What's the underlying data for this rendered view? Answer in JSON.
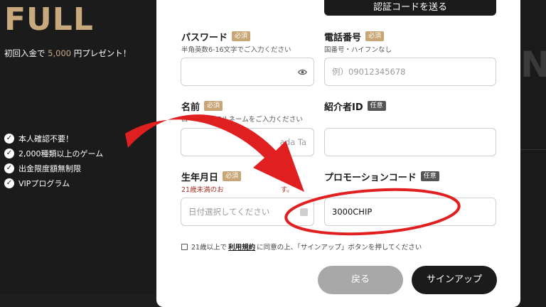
{
  "promo": {
    "title": "FULL",
    "bonus_prefix": "初回入金で",
    "bonus_amount": "5,000",
    "bonus_suffix": "円プレゼント！",
    "features": [
      "本人確認不要！",
      "2,000種類以上のゲーム",
      "出金限度額無制限",
      "VIPプログラム"
    ]
  },
  "form": {
    "auth_button": "認証コードを送る",
    "password": {
      "label": "パスワード",
      "badge": "必須",
      "hint": "半角英数6-16文字でご入力ください",
      "value": ""
    },
    "phone": {
      "label": "電話番号",
      "badge": "必須",
      "hint": "国番号・ハイフンなし",
      "placeholder": "例）09012345678"
    },
    "name": {
      "label": "名前",
      "badge": "必須",
      "hint": "ローマ字でフルネームをご入力ください",
      "placeholder": "Yamada Taro",
      "visible_placeholder": "ada Ta"
    },
    "referrer": {
      "label": "紹介者ID",
      "badge": "任意",
      "value": ""
    },
    "birthday": {
      "label": "生年月日",
      "badge": "必須",
      "hint_start": "21歳未満のお",
      "hint_end": "す。",
      "placeholder": "日付選択してください"
    },
    "promo_code": {
      "label": "プロモーションコード",
      "badge": "任意",
      "value": "3000CHIP"
    },
    "agreement": {
      "prefix": "21歳以上で",
      "terms_link": "利用規約",
      "suffix": "に同意の上、「サインアップ」ボタンを押してください"
    },
    "back_button": "戻る",
    "signup_button": "サインアップ"
  },
  "background": {
    "ghost_letter": "N"
  },
  "colors": {
    "gold": "#c8a97e",
    "dark": "#1b1b1b",
    "annotation_red": "#e02020"
  }
}
